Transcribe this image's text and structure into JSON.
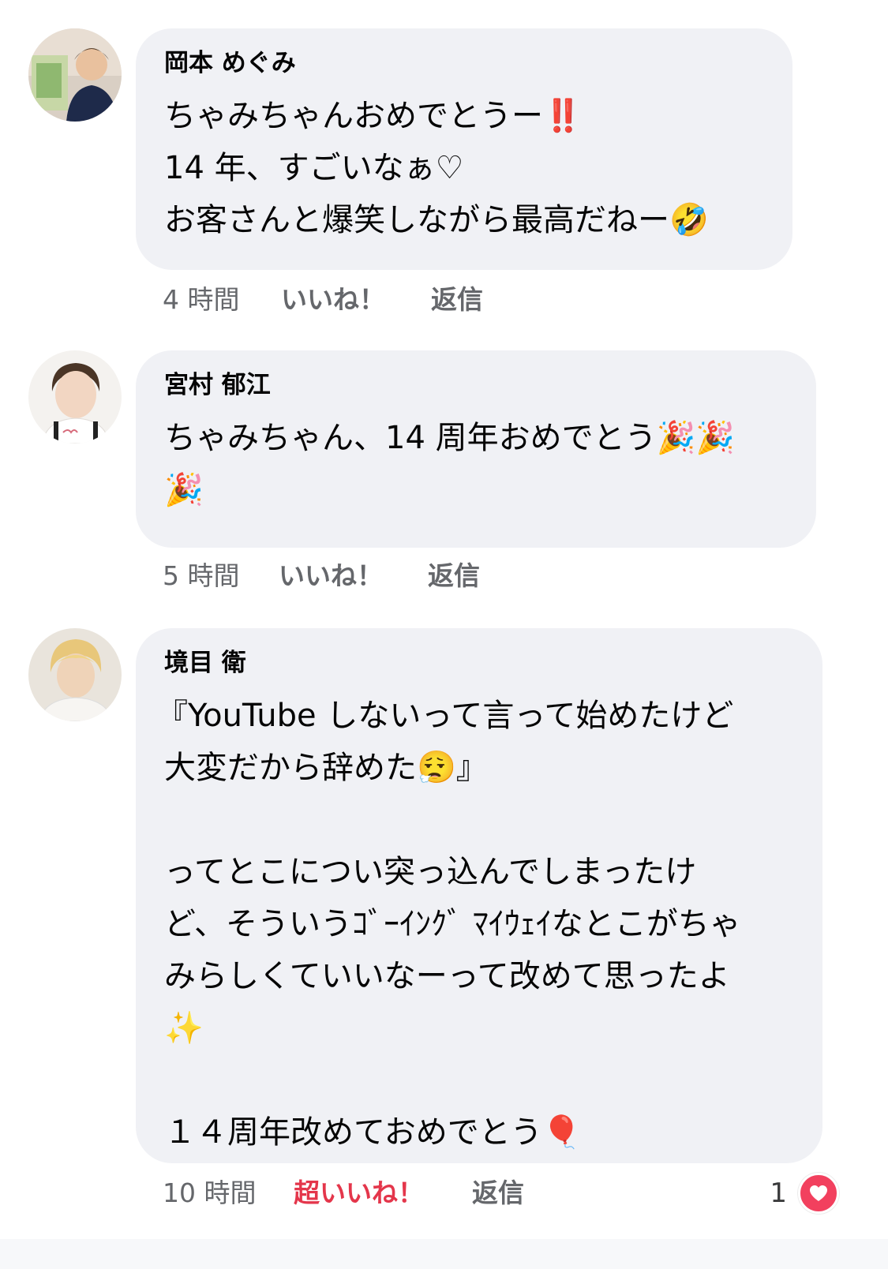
{
  "comments": [
    {
      "author": "岡本 めぐみ",
      "lines": [
        "ちゃみちゃんおめでとうー‼️",
        "14 年、すごいなぁ♡",
        "お客さんと爆笑しながら最高だねー🤣"
      ],
      "time": "4 時間",
      "like_label": "いいね！",
      "reply_label": "返信"
    },
    {
      "author": "宮村 郁江",
      "lines": [
        "ちゃみちゃん、14 周年おめでとう🎉🎉",
        "🎉"
      ],
      "time": "5 時間",
      "like_label": "いいね！",
      "reply_label": "返信"
    },
    {
      "author": "境目 衛",
      "lines": [
        "『YouTube しないって言って始めたけど",
        "大変だから辞めた😮‍💨』",
        "",
        "ってとこについ突っ込んでしまったけ",
        "ど、そういうｺﾞｰｲﾝｸﾞ ﾏｲｳｪｲなとこがちゃ",
        "みらしくていいなーって改めて思ったよ",
        "✨",
        "",
        "１４周年改めておめでとう🎈"
      ],
      "time": "10 時間",
      "like_label": "超いいね！",
      "reply_label": "返信",
      "reaction_count": "1",
      "reaction_icon": "heart-icon"
    }
  ],
  "colors": {
    "bubble": "#f0f1f5",
    "meta_text": "#65676b",
    "super_like": "#e4364b",
    "heart_badge": "#f2405e"
  }
}
